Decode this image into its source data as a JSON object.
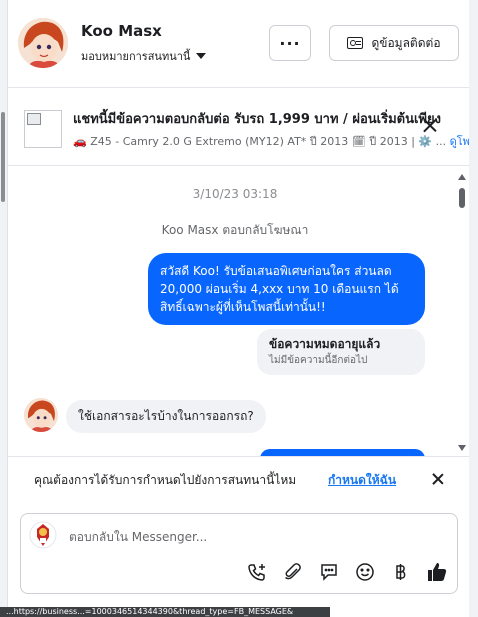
{
  "header": {
    "user_name": "Koo Masx",
    "assign_label": "มอบหมายการสนทนานี้",
    "more_label": "···",
    "contact_label": "ดูข้อมูลติดต่อ"
  },
  "listing": {
    "title": "แชทนี้มีข้อความตอบกลับต่อ รับรถ 1,999 บาท / ผ่อนเริ่มต้นเพียง",
    "subtitle_prefix": "🚗 Z45 - Camry 2.0 G Extremo (MY12) AT* ปี 2013 🗓 ปี 2013 | ⚙️ ...",
    "subtitle_link": "ดูโพ"
  },
  "chat": {
    "timestamp": "3/10/23 03:18",
    "ad_reply_note": "Koo Masx ตอบกลับโฆษณา",
    "outgoing_message": "สวัสดี Koo! รับข้อเสนอพิเศษก่อนใคร ส่วนลด 20,000 ผ่อนเริ่ม 4,xxx บาท 10 เดือนแรก ได้สิทธิ์เฉพาะผู้ที่เห็นโพสนี้เท่านั้น!!",
    "expired_title": "ข้อความหมดอายุแล้ว",
    "expired_subtitle": "ไม่มีข้อความนี้อีกต่อไป",
    "incoming_message": "ใช้เอกสารอะไรบ้างในการออกรถ?"
  },
  "reminder": {
    "text": "คุณต้องการได้รับการกำหนดไปยังการสนทนานี้ไหม",
    "link": "กำหนดให้ฉัน"
  },
  "composer": {
    "placeholder": "ตอบกลับใน Messenger..."
  },
  "status_bar": {
    "url": "...https://business...=1000346514344390&thread_type=FB_MESSAGE&"
  },
  "colors": {
    "accent": "#0866ff",
    "link": "#1877f2",
    "bubble_incoming": "#f0f2f5"
  },
  "icons": [
    "more-icon",
    "id-card-icon",
    "close-icon",
    "add-call-icon",
    "attachment-icon",
    "chat-icon",
    "emoji-icon",
    "baht-icon",
    "like-icon"
  ]
}
